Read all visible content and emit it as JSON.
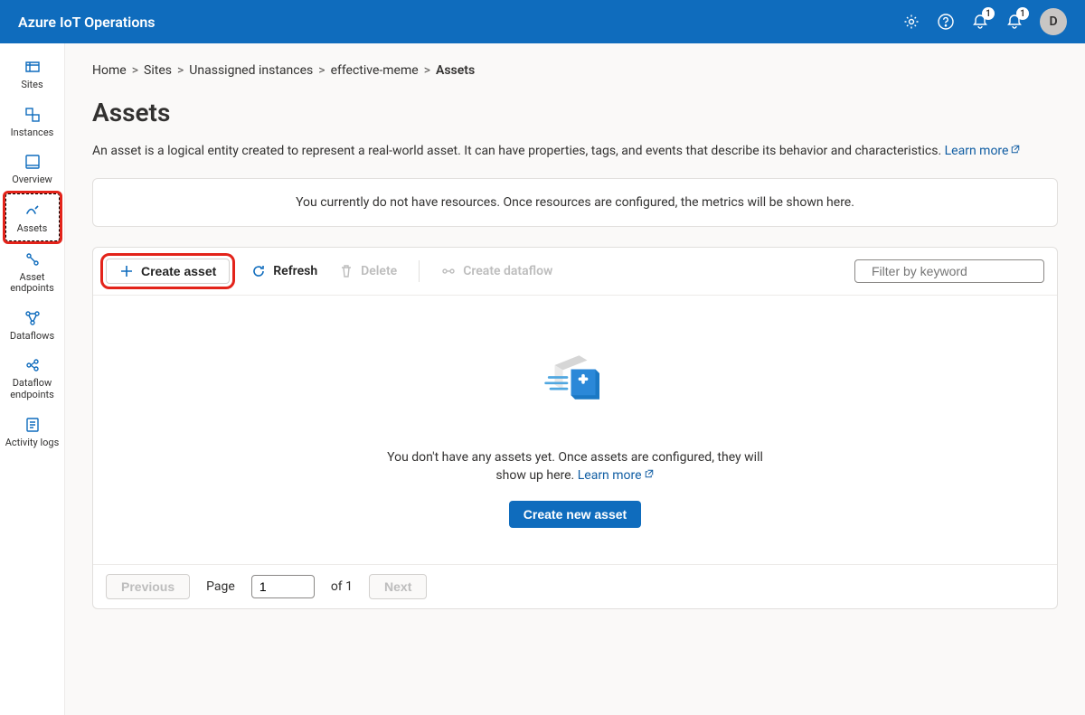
{
  "header": {
    "title": "Azure IoT Operations",
    "notification_badge1": "1",
    "notification_badge2": "1",
    "avatar_initial": "D"
  },
  "sidenav": {
    "items": [
      {
        "label": "Sites"
      },
      {
        "label": "Instances"
      },
      {
        "label": "Overview"
      },
      {
        "label": "Assets"
      },
      {
        "label": "Asset endpoints"
      },
      {
        "label": "Dataflows"
      },
      {
        "label": "Dataflow endpoints"
      },
      {
        "label": "Activity logs"
      }
    ]
  },
  "breadcrumb": {
    "home": "Home",
    "sites": "Sites",
    "unassigned": "Unassigned instances",
    "instance": "effective-meme",
    "current": "Assets"
  },
  "page": {
    "title": "Assets",
    "subtext": "An asset is a logical entity created to represent a real-world asset. It can have properties, tags, and events that describe its behavior and characteristics. ",
    "learn_more": "Learn more",
    "info_card": "You currently do not have resources. Once resources are configured, the metrics will be shown here."
  },
  "toolbar": {
    "create_asset": "Create asset",
    "refresh": "Refresh",
    "delete": "Delete",
    "create_dataflow": "Create dataflow",
    "filter_placeholder": "Filter by keyword"
  },
  "empty": {
    "text": "You don't have any assets yet. Once assets are configured, they will show up here. ",
    "learn_more": "Learn more",
    "button": "Create new asset"
  },
  "pager": {
    "previous": "Previous",
    "page_label": "Page",
    "page_value": "1",
    "of_label": "of 1",
    "next": "Next"
  }
}
